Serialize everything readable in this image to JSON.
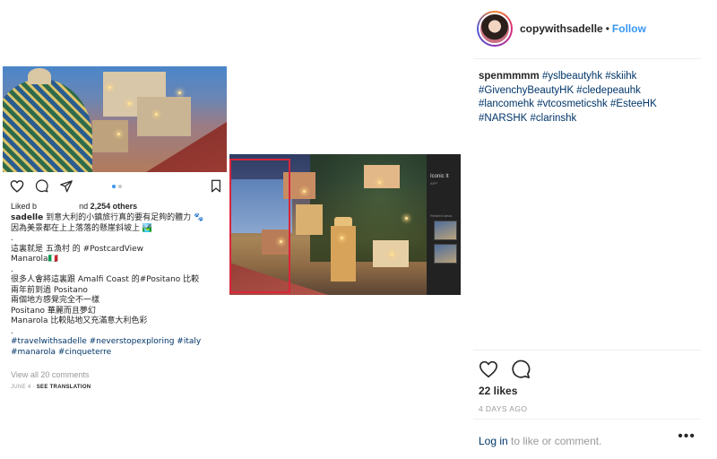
{
  "post_media": {
    "liked_prefix": "Liked b",
    "liked_mid": "nd",
    "liked_count": "2,254 others",
    "caption_user": "sadelle",
    "caption_lines": [
      " 到意大利的小鎮旅行真的要有足夠的體力",
      "因為美景都在上上落落的懸崖斜坡上",
      ".",
      "這裏就是 五漁村 的 #PostcardView",
      "Manarola",
      ".",
      "很多人會將這裏跟 Amalfi Coast 的#Positano 比較",
      "兩年前到過 Positano",
      "兩個地方感覺完全不一樣",
      "Positano 華麗而且夢幻",
      "Manarola 比較貼地又充滿意大利色彩",
      ".",
      "#travelwithsadelle #neverstopexploring #italy",
      "#manarola #cinqueterre"
    ],
    "view_all": "View all 20 comments",
    "date_prefix": "JUNE 4 · ",
    "see_translation": "SEE TRANSLATION",
    "overlay_panel_title": "Iconic It",
    "overlay_panel_sub": "APP",
    "overlay_panel_label": "Related ideas"
  },
  "sidebar": {
    "username": "copywithsadelle",
    "separator": "•",
    "follow_label": "Follow",
    "comment_user": "spenmmmm",
    "comment_tags": "#yslbeautyhk #skiihk #GivenchyBeautyHK #cledepeauhk #lancomehk #vtcosmeticshk #EsteeHK #NARSHK #clarinshk",
    "likes": "22 likes",
    "time_ago": "4 DAYS AGO",
    "login_label": "Log in",
    "login_suffix": " to like or comment.",
    "more_label": "•••"
  },
  "colors": {
    "link_blue": "#3897f0",
    "hashtag": "#003569",
    "muted": "#999999",
    "selection_red": "#d8263b"
  }
}
